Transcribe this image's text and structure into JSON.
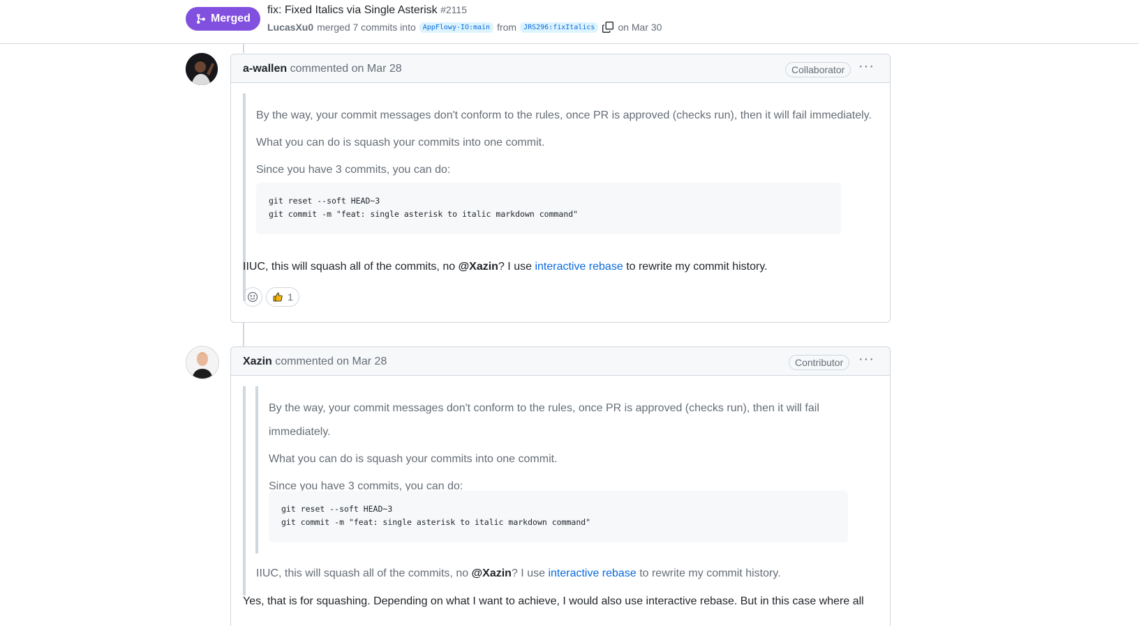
{
  "pr": {
    "status_label": "Merged",
    "title": "fix: Fixed Italics via Single Asterisk",
    "number": "#2115",
    "merged_by": "LucasXu0",
    "merge_text": "merged 7 commits into",
    "base_branch": "AppFlowy-IO:main",
    "from_text": "from",
    "head_branch": "JRS296:fixItalics",
    "date_text": "on Mar 30"
  },
  "comments": [
    {
      "author": "a-wallen",
      "action": "commented",
      "date": "on Mar 28",
      "role": "Collaborator",
      "quote_lines": [
        "By the way, your commit messages don't conform to the rules, once PR is approved (checks run), then it will fail immediately.",
        "What you can do is squash your commits into one commit.",
        "Since you have 3 commits, you can do:"
      ],
      "code": [
        "git reset --soft HEAD~3",
        "git commit -m \"feat: single asterisk to italic markdown command\""
      ],
      "reply_pre": "IIUC, this will squash all of the commits, no",
      "reply_mention": "@Xazin",
      "reply_mid": "? I use",
      "reply_link": "interactive rebase",
      "reply_post": "to rewrite my commit history.",
      "reaction_thumbs_count": "1"
    },
    {
      "author": "Xazin",
      "action": "commented",
      "date": "on Mar 28",
      "role": "Contributor",
      "quote_lines": [
        "By the way, your commit messages don't conform to the rules, once PR is approved (checks run), then it will fail",
        "immediately.",
        "What you can do is squash your commits into one commit.",
        "Since you have 3 commits, you can do:"
      ],
      "code": [
        "git reset --soft HEAD~3",
        "git commit -m \"feat: single asterisk to italic markdown command\""
      ],
      "quote2_pre": "IIUC, this will squash all of the commits, no",
      "quote2_mention": "@Xazin",
      "quote2_mid": "? I use",
      "quote2_link": "interactive rebase",
      "quote2_post": "to rewrite my commit history.",
      "reply": "Yes, that is for squashing. Depending on what I want to achieve, I would also use interactive rebase. But in this case where all"
    }
  ],
  "colors": {
    "merged_purple": "#8250df",
    "link_blue": "#0969da",
    "border": "#d0d7de",
    "muted_text": "#656d76"
  }
}
